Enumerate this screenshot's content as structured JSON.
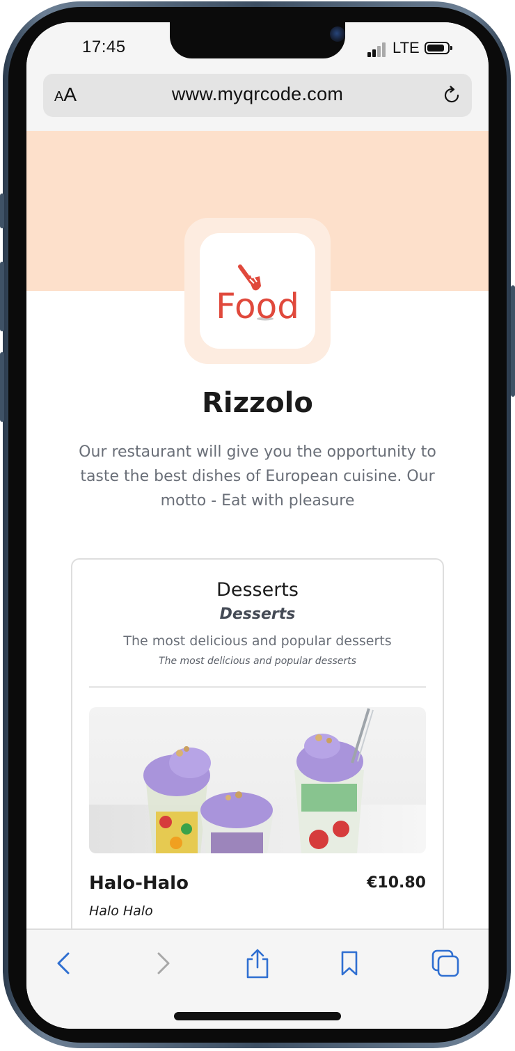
{
  "status_bar": {
    "time": "17:45",
    "network": "LTE"
  },
  "browser": {
    "text_size_small": "A",
    "text_size_big": "A",
    "url": "www.myqrcode.com",
    "toolbar_icons": [
      "back-icon",
      "forward-icon",
      "share-icon",
      "bookmarks-icon",
      "tabs-icon"
    ]
  },
  "restaurant": {
    "logo_text": "Food",
    "name": "Rizzolo",
    "description": "Our restaurant will give you the opportunity to taste the best dishes of European cuisine. Our motto - Eat with pleasure"
  },
  "menu": {
    "category": {
      "title": "Desserts",
      "title_alt": "Desserts",
      "description": "The most delicious and popular desserts",
      "description_alt": "The most delicious and popular desserts"
    },
    "items": [
      {
        "name": "Halo-Halo",
        "name_alt": "Halo Halo",
        "price": "€10.80"
      }
    ]
  },
  "colors": {
    "banner": "#fde0cb",
    "logo_red": "#e0493c",
    "accent_blue": "#2f6fd1",
    "text_dark": "#1b1b1b",
    "text_muted": "#6a6f78"
  }
}
